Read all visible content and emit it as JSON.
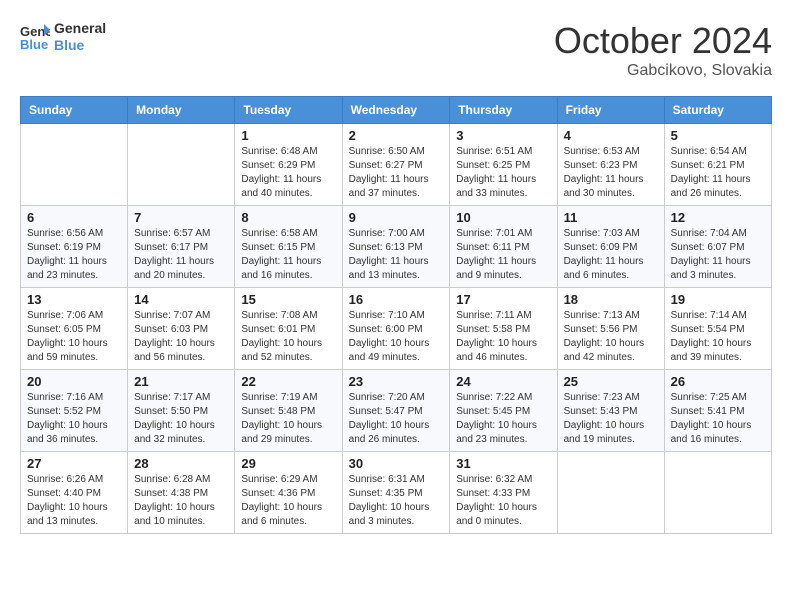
{
  "header": {
    "logo_line1": "General",
    "logo_line2": "Blue",
    "month": "October 2024",
    "location": "Gabcikovo, Slovakia"
  },
  "days_of_week": [
    "Sunday",
    "Monday",
    "Tuesday",
    "Wednesday",
    "Thursday",
    "Friday",
    "Saturday"
  ],
  "weeks": [
    [
      {
        "day": "",
        "content": ""
      },
      {
        "day": "",
        "content": ""
      },
      {
        "day": "1",
        "content": "Sunrise: 6:48 AM\nSunset: 6:29 PM\nDaylight: 11 hours and 40 minutes."
      },
      {
        "day": "2",
        "content": "Sunrise: 6:50 AM\nSunset: 6:27 PM\nDaylight: 11 hours and 37 minutes."
      },
      {
        "day": "3",
        "content": "Sunrise: 6:51 AM\nSunset: 6:25 PM\nDaylight: 11 hours and 33 minutes."
      },
      {
        "day": "4",
        "content": "Sunrise: 6:53 AM\nSunset: 6:23 PM\nDaylight: 11 hours and 30 minutes."
      },
      {
        "day": "5",
        "content": "Sunrise: 6:54 AM\nSunset: 6:21 PM\nDaylight: 11 hours and 26 minutes."
      }
    ],
    [
      {
        "day": "6",
        "content": "Sunrise: 6:56 AM\nSunset: 6:19 PM\nDaylight: 11 hours and 23 minutes."
      },
      {
        "day": "7",
        "content": "Sunrise: 6:57 AM\nSunset: 6:17 PM\nDaylight: 11 hours and 20 minutes."
      },
      {
        "day": "8",
        "content": "Sunrise: 6:58 AM\nSunset: 6:15 PM\nDaylight: 11 hours and 16 minutes."
      },
      {
        "day": "9",
        "content": "Sunrise: 7:00 AM\nSunset: 6:13 PM\nDaylight: 11 hours and 13 minutes."
      },
      {
        "day": "10",
        "content": "Sunrise: 7:01 AM\nSunset: 6:11 PM\nDaylight: 11 hours and 9 minutes."
      },
      {
        "day": "11",
        "content": "Sunrise: 7:03 AM\nSunset: 6:09 PM\nDaylight: 11 hours and 6 minutes."
      },
      {
        "day": "12",
        "content": "Sunrise: 7:04 AM\nSunset: 6:07 PM\nDaylight: 11 hours and 3 minutes."
      }
    ],
    [
      {
        "day": "13",
        "content": "Sunrise: 7:06 AM\nSunset: 6:05 PM\nDaylight: 10 hours and 59 minutes."
      },
      {
        "day": "14",
        "content": "Sunrise: 7:07 AM\nSunset: 6:03 PM\nDaylight: 10 hours and 56 minutes."
      },
      {
        "day": "15",
        "content": "Sunrise: 7:08 AM\nSunset: 6:01 PM\nDaylight: 10 hours and 52 minutes."
      },
      {
        "day": "16",
        "content": "Sunrise: 7:10 AM\nSunset: 6:00 PM\nDaylight: 10 hours and 49 minutes."
      },
      {
        "day": "17",
        "content": "Sunrise: 7:11 AM\nSunset: 5:58 PM\nDaylight: 10 hours and 46 minutes."
      },
      {
        "day": "18",
        "content": "Sunrise: 7:13 AM\nSunset: 5:56 PM\nDaylight: 10 hours and 42 minutes."
      },
      {
        "day": "19",
        "content": "Sunrise: 7:14 AM\nSunset: 5:54 PM\nDaylight: 10 hours and 39 minutes."
      }
    ],
    [
      {
        "day": "20",
        "content": "Sunrise: 7:16 AM\nSunset: 5:52 PM\nDaylight: 10 hours and 36 minutes."
      },
      {
        "day": "21",
        "content": "Sunrise: 7:17 AM\nSunset: 5:50 PM\nDaylight: 10 hours and 32 minutes."
      },
      {
        "day": "22",
        "content": "Sunrise: 7:19 AM\nSunset: 5:48 PM\nDaylight: 10 hours and 29 minutes."
      },
      {
        "day": "23",
        "content": "Sunrise: 7:20 AM\nSunset: 5:47 PM\nDaylight: 10 hours and 26 minutes."
      },
      {
        "day": "24",
        "content": "Sunrise: 7:22 AM\nSunset: 5:45 PM\nDaylight: 10 hours and 23 minutes."
      },
      {
        "day": "25",
        "content": "Sunrise: 7:23 AM\nSunset: 5:43 PM\nDaylight: 10 hours and 19 minutes."
      },
      {
        "day": "26",
        "content": "Sunrise: 7:25 AM\nSunset: 5:41 PM\nDaylight: 10 hours and 16 minutes."
      }
    ],
    [
      {
        "day": "27",
        "content": "Sunrise: 6:26 AM\nSunset: 4:40 PM\nDaylight: 10 hours and 13 minutes."
      },
      {
        "day": "28",
        "content": "Sunrise: 6:28 AM\nSunset: 4:38 PM\nDaylight: 10 hours and 10 minutes."
      },
      {
        "day": "29",
        "content": "Sunrise: 6:29 AM\nSunset: 4:36 PM\nDaylight: 10 hours and 6 minutes."
      },
      {
        "day": "30",
        "content": "Sunrise: 6:31 AM\nSunset: 4:35 PM\nDaylight: 10 hours and 3 minutes."
      },
      {
        "day": "31",
        "content": "Sunrise: 6:32 AM\nSunset: 4:33 PM\nDaylight: 10 hours and 0 minutes."
      },
      {
        "day": "",
        "content": ""
      },
      {
        "day": "",
        "content": ""
      }
    ]
  ]
}
